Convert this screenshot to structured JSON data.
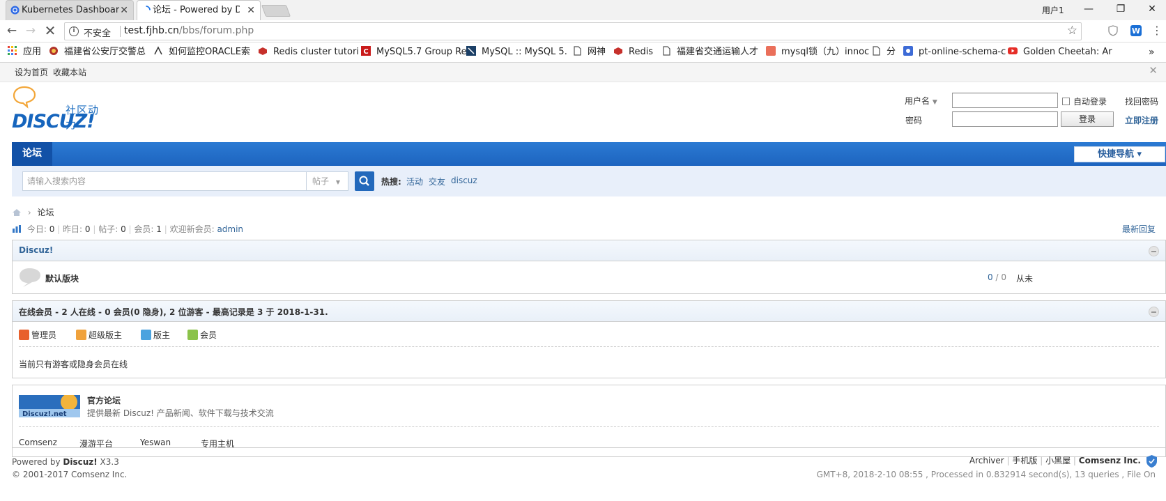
{
  "browser": {
    "tabs": [
      {
        "title": "Kubernetes Dashboard",
        "active": false
      },
      {
        "title": "论坛 - Powered by Disc",
        "active": true
      }
    ],
    "window_user": "用户1",
    "window_buttons": [
      "—",
      "❐",
      "✕"
    ],
    "security_label": "不安全",
    "url_host": "test.fjhb.cn",
    "url_path": "/bbs/forum.php",
    "bookmarks": [
      {
        "label": "应用",
        "icon": "apps-grid-icon"
      },
      {
        "label": "福建省公安厅交警总",
        "icon": "site-icon"
      },
      {
        "label": "如何监控ORACLE索",
        "icon": "site-icon"
      },
      {
        "label": "Redis cluster tutori",
        "icon": "redis-icon"
      },
      {
        "label": "MySQL5.7 Group Re",
        "icon": "csdn-icon"
      },
      {
        "label": "MySQL :: MySQL 5.",
        "icon": "mysql-icon"
      },
      {
        "label": "网神",
        "icon": "page-icon"
      },
      {
        "label": "Redis",
        "icon": "redis-icon"
      },
      {
        "label": "福建省交通运输人才",
        "icon": "page-icon"
      },
      {
        "label": "mysql锁（九）innoc",
        "icon": "jianshu-icon"
      },
      {
        "label": "分",
        "icon": "page-icon"
      },
      {
        "label": "pt-online-schema-c",
        "icon": "site-icon"
      },
      {
        "label": "Golden Cheetah: Ar",
        "icon": "youtube-icon"
      }
    ],
    "bookmarks_more": "»"
  },
  "topbar": {
    "set_home": "设为首页",
    "bookmark_site": "收藏本站",
    "close": "✕"
  },
  "logo": {
    "slogan": "社区动力",
    "text": "DISCUZ!"
  },
  "login": {
    "username_label": "用户名",
    "password_label": "密码",
    "auto_login": "自动登录",
    "login_button": "登录",
    "find_password": "找回密码",
    "register": "立即注册"
  },
  "nav": {
    "forum": "论坛",
    "quick_nav": "快捷导航 ▾"
  },
  "search": {
    "placeholder": "请输入搜索内容",
    "type": "帖子",
    "hot_label": "热搜:",
    "hot_links": [
      "活动",
      "交友",
      "discuz"
    ]
  },
  "breadcrumb": {
    "current": "论坛"
  },
  "stats": {
    "today_label": "今日: ",
    "today": "0",
    "yesterday_label": "昨日: ",
    "yesterday": "0",
    "posts_label": "帖子: ",
    "posts": "0",
    "members_label": "会员: ",
    "members": "1",
    "welcome_label": "欢迎新会员: ",
    "newest_member": "admin",
    "latest_reply": "最新回复"
  },
  "category": {
    "title": "Discuz!",
    "forums": [
      {
        "name": "默认版块",
        "threads": "0",
        "posts": "0",
        "last_post": "从未"
      }
    ]
  },
  "online": {
    "title": "在线会员 - 2 人在线 - 0 会员(0 隐身), 2 位游客 - 最高记录是 3 于 2018-1-31.",
    "legend": [
      {
        "label": "管理员",
        "color": "#e8602c"
      },
      {
        "label": "超级版主",
        "color": "#f0a23c"
      },
      {
        "label": "版主",
        "color": "#4aa3df"
      },
      {
        "label": "会员",
        "color": "#8bc34a"
      }
    ],
    "empty_text": "当前只有游客或隐身会员在线"
  },
  "links": {
    "official_title": "官方论坛",
    "official_desc": "提供最新 Discuz! 产品新闻、软件下载与技术交流",
    "logo_text": "Discuz!.net",
    "partners": [
      "Comsenz",
      "漫游平台",
      "Yeswan",
      "专用主机"
    ]
  },
  "footer": {
    "powered_prefix": "Powered by ",
    "powered_name": "Discuz!",
    "version": "X3.3",
    "copyright": "© 2001-2017 Comsenz Inc.",
    "links": [
      "Archiver",
      "手机版",
      "小黑屋",
      "Comsenz Inc."
    ],
    "debug": "GMT+8, 2018-2-10 08:55 , Processed in 0.832914 second(s), 13 queries , File On"
  }
}
